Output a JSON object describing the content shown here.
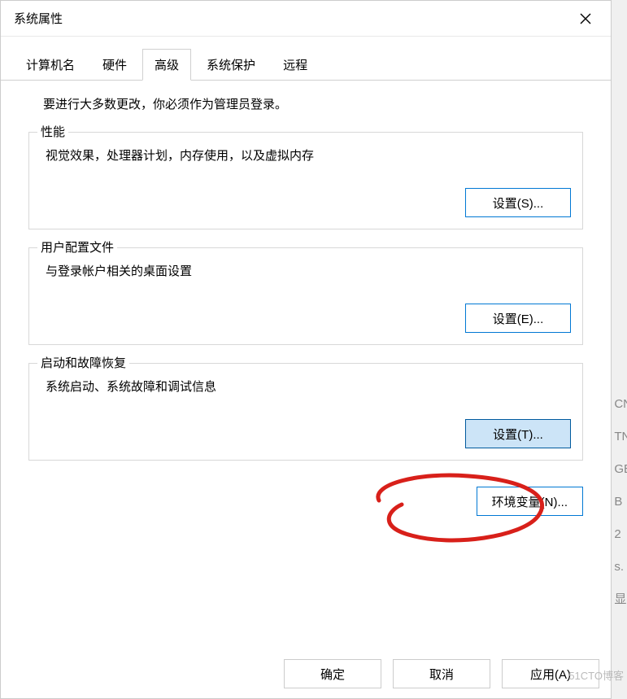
{
  "window": {
    "title": "系统属性"
  },
  "tabs": {
    "computer_name": "计算机名",
    "hardware": "硬件",
    "advanced": "高级",
    "system_protection": "系统保护",
    "remote": "远程"
  },
  "admin_note": "要进行大多数更改，你必须作为管理员登录。",
  "performance": {
    "title": "性能",
    "desc": "视觉效果，处理器计划，内存使用，以及虚拟内存",
    "button": "设置(S)..."
  },
  "user_profiles": {
    "title": "用户配置文件",
    "desc": "与登录帐户相关的桌面设置",
    "button": "设置(E)..."
  },
  "startup_recovery": {
    "title": "启动和故障恢复",
    "desc": "系统启动、系统故障和调试信息",
    "button": "设置(T)..."
  },
  "env_vars": {
    "button": "环境变量(N)..."
  },
  "footer": {
    "ok": "确定",
    "cancel": "取消",
    "apply": "应用(A)"
  },
  "bg_text": [
    "CN",
    "TN",
    "GE",
    "B",
    "2",
    "s.",
    "显"
  ],
  "watermark": "51CTO博客"
}
